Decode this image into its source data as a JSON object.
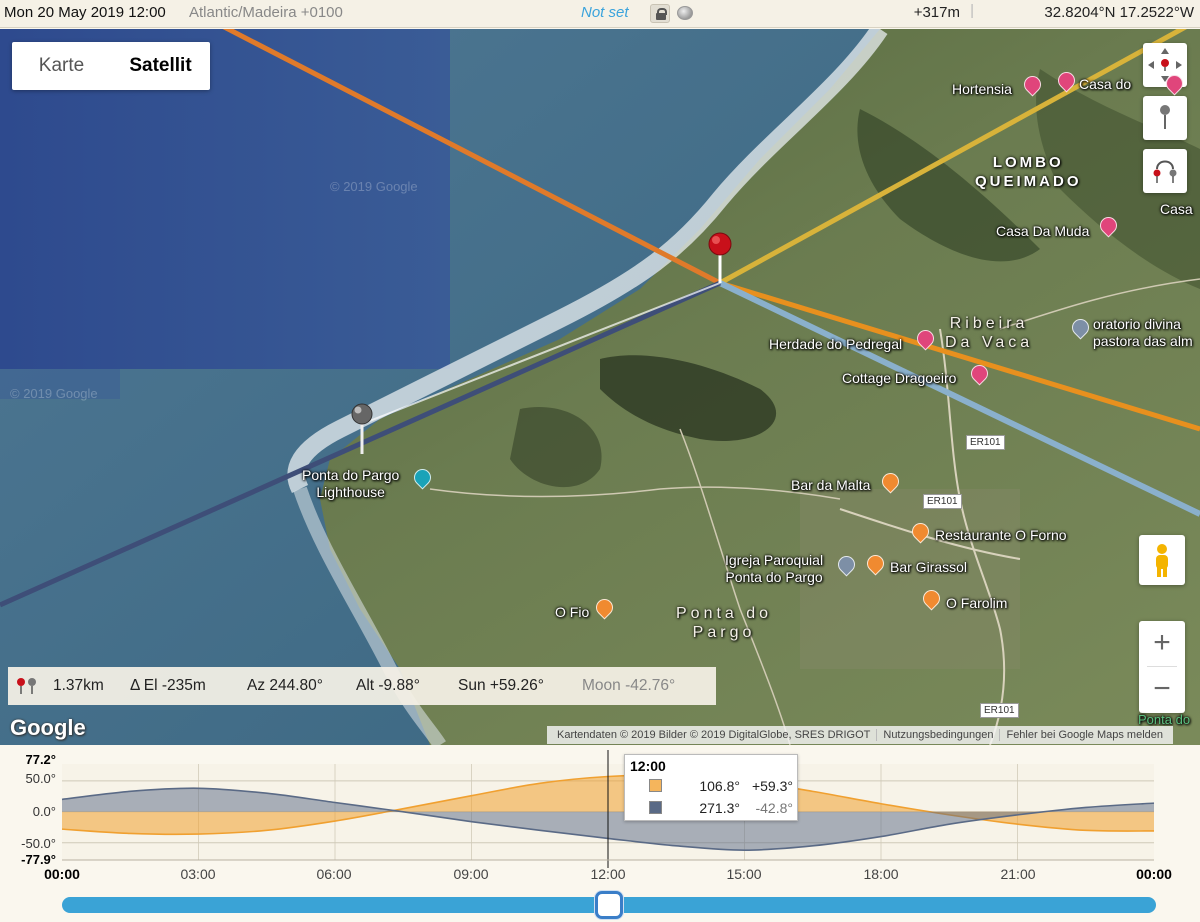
{
  "topbar": {
    "datetime": "Mon 20 May 2019 12:00",
    "timezone": "Atlantic/Madeira +0100",
    "status": "Not set",
    "elevation": "+317m",
    "separator": "|",
    "coordinates": "32.8204°N 17.2522°W"
  },
  "map": {
    "map_type": {
      "options": [
        "Karte",
        "Satellit"
      ],
      "selected": "Satellit"
    },
    "watermark": "© 2019 Google",
    "places": {
      "hortensia": "Hortensia",
      "casa_do": "Casa do",
      "casa": "Casa",
      "casa_da_muda": "Casa Da Muda",
      "herdade": "Herdade do Pedregal",
      "cottage": "Cottage Dragoeiro",
      "oratorio_1": "oratorio divina",
      "oratorio_2": "pastora das alm",
      "lighthouse_1": "Ponta do Pargo",
      "lighthouse_2": "Lighthouse",
      "bar_malta": "Bar da Malta",
      "restaurante": "Restaurante O Forno",
      "igreja_1": "Igreja Paroquial",
      "igreja_2": "Ponta do Pargo",
      "bar_girassol": "Bar Girassol",
      "o_fio": "O Fio",
      "o_farolim": "O Farolim",
      "ponta_edge": "Ponta do"
    },
    "areas": {
      "lombo_1": "LOMBO",
      "lombo_2": "QUEIMADO",
      "ribeira_1": "Ribeira",
      "ribeira_2": "Da Vaca",
      "ponta_1": "Ponta do",
      "ponta_2": "Pargo"
    },
    "roads": [
      "ER101",
      "ER101",
      "ER101"
    ],
    "zoom_in": "+",
    "zoom_out": "−"
  },
  "infobar": {
    "distance": "1.37km",
    "delta_el": "Δ El  -235m",
    "azimuth": "Az 244.80°",
    "altitude": "Alt  -9.88°",
    "sun": "Sun +59.26°",
    "moon": "Moon -42.76°"
  },
  "google_logo": "Google",
  "attribution": {
    "data": "Kartendaten © 2019 Bilder © 2019 DigitalGlobe, SRES DRIGOT",
    "terms": "Nutzungsbedingungen",
    "report": "Fehler bei Google Maps melden"
  },
  "chart_data": {
    "type": "area",
    "y_labels": [
      "77.2°",
      "50.0°",
      "0.0°",
      "-50.0°",
      "-77.9°"
    ],
    "ylim": [
      -77.9,
      77.2
    ],
    "x_ticks": [
      "00:00",
      "03:00",
      "06:00",
      "09:00",
      "12:00",
      "15:00",
      "18:00",
      "21:00",
      "00:00"
    ],
    "x": [
      0,
      1.5,
      3,
      4.5,
      6,
      7.5,
      9,
      10.5,
      12,
      13.5,
      15,
      16.5,
      18,
      19.5,
      21,
      22.5,
      24
    ],
    "series": [
      {
        "color": "#f0a030",
        "values": [
          -28,
          -35,
          -36,
          -30,
          -15,
          5,
          26,
          46,
          57,
          59,
          50,
          33,
          13,
          -5,
          -20,
          -30,
          -31
        ]
      },
      {
        "color": "#5a6a86",
        "values": [
          20,
          33,
          38,
          30,
          15,
          0,
          -16,
          -30,
          -43,
          -55,
          -62,
          -55,
          -40,
          -20,
          -5,
          7,
          14
        ]
      }
    ],
    "grid": true,
    "cursor": "12:00",
    "tooltip": {
      "time": "12:00",
      "rows": [
        {
          "color": "#f5b55c",
          "azimuth": "106.8°",
          "elevation": "+59.3°"
        },
        {
          "color": "#5a6a86",
          "azimuth": "271.3°",
          "elevation": "-42.8°"
        }
      ]
    }
  }
}
